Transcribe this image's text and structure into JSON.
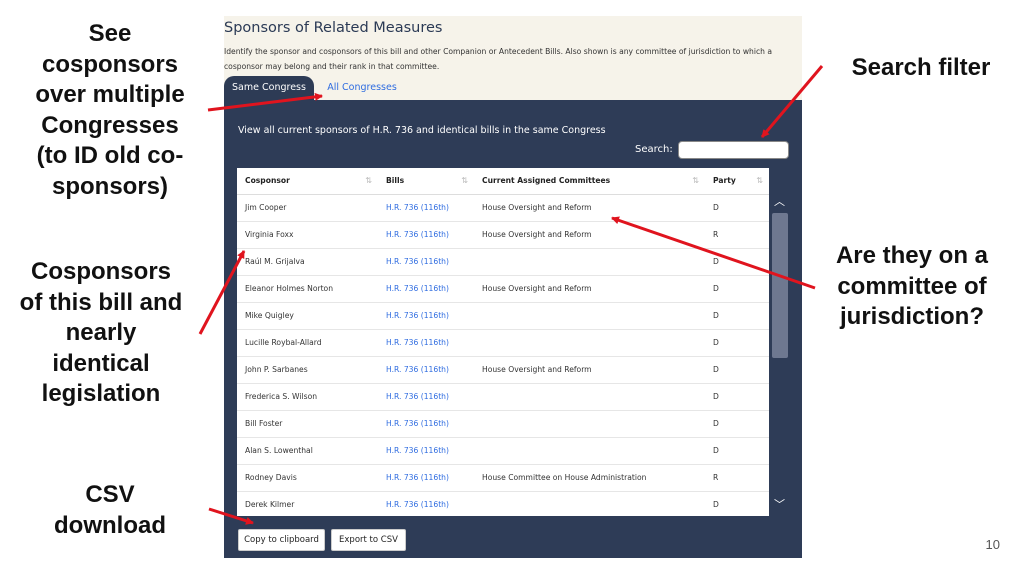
{
  "annotations": {
    "multi_congress": "See\ncosponsors\nover multiple\nCongresses\n(to ID old co-\nsponsors)",
    "cosponsors": "Cosponsors\nof this bill and\nnearly\nidentical\nlegislation",
    "csv": "CSV\ndownload",
    "search": "Search filter",
    "committee": "Are they on a\ncommittee of\njurisdiction?"
  },
  "slide_number": "10",
  "widget": {
    "title": "Sponsors of Related Measures",
    "description": "Identify the sponsor and cosponsors of this bill and other Companion or Antecedent Bills. Also shown is any committee of jurisdiction to which a cosponsor may belong and their rank in that committee.",
    "tabs": {
      "same": "Same Congress",
      "all": "All Congresses"
    },
    "heading": "View all current sponsors of H.R. 736 and identical bills in the same Congress",
    "search_label": "Search:",
    "search_value": "",
    "columns": {
      "cosponsor": "Cosponsor",
      "bills": "Bills",
      "committees": "Current Assigned Committees",
      "party": "Party"
    },
    "rows": [
      {
        "name": "Jim Cooper",
        "bill": "H.R. 736 (116th)",
        "committee": "House Oversight and Reform",
        "party": "D"
      },
      {
        "name": "Virginia Foxx",
        "bill": "H.R. 736 (116th)",
        "committee": "House Oversight and Reform",
        "party": "R"
      },
      {
        "name": "Raúl M. Grijalva",
        "bill": "H.R. 736 (116th)",
        "committee": "",
        "party": "D"
      },
      {
        "name": "Eleanor Holmes Norton",
        "bill": "H.R. 736 (116th)",
        "committee": "House Oversight and Reform",
        "party": "D"
      },
      {
        "name": "Mike Quigley",
        "bill": "H.R. 736 (116th)",
        "committee": "",
        "party": "D"
      },
      {
        "name": "Lucille Roybal-Allard",
        "bill": "H.R. 736 (116th)",
        "committee": "",
        "party": "D"
      },
      {
        "name": "John P. Sarbanes",
        "bill": "H.R. 736 (116th)",
        "committee": "House Oversight and Reform",
        "party": "D"
      },
      {
        "name": "Frederica S. Wilson",
        "bill": "H.R. 736 (116th)",
        "committee": "",
        "party": "D"
      },
      {
        "name": "Bill Foster",
        "bill": "H.R. 736 (116th)",
        "committee": "",
        "party": "D"
      },
      {
        "name": "Alan S. Lowenthal",
        "bill": "H.R. 736 (116th)",
        "committee": "",
        "party": "D"
      },
      {
        "name": "Rodney Davis",
        "bill": "H.R. 736 (116th)",
        "committee": "House Committee on House Administration",
        "party": "R"
      },
      {
        "name": "Derek Kilmer",
        "bill": "H.R. 736 (116th)",
        "committee": "",
        "party": "D"
      }
    ],
    "buttons": {
      "copy": "Copy to clipboard",
      "csv": "Export to CSV"
    }
  },
  "colors": {
    "panel": "#2e3c57",
    "link": "#2f6ce0",
    "arrow": "#e0141e"
  }
}
